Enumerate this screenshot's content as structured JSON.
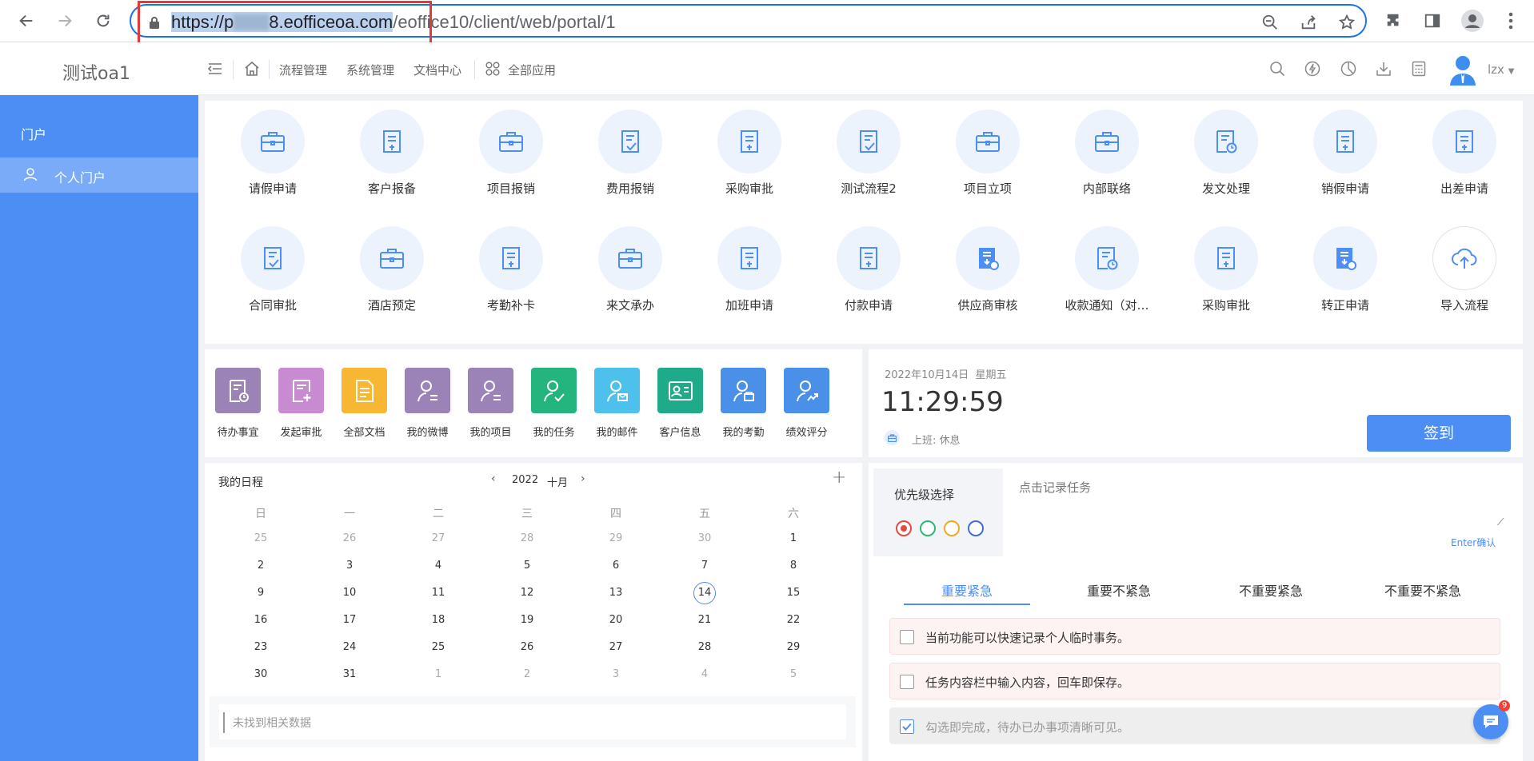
{
  "browser": {
    "url_selected": "https://p",
    "url_selected_tail": "8.eofficeoa.com",
    "url_rest": "/eoffice10/client/web/portal/1"
  },
  "header": {
    "app_title": "测试oa1",
    "nav": [
      "流程管理",
      "系统管理",
      "文档中心",
      "全部应用"
    ],
    "user_name": "lzx"
  },
  "sidebar": {
    "heading": "门户",
    "items": [
      {
        "label": "个人门户"
      }
    ]
  },
  "apps": [
    {
      "label": "请假申请",
      "icon": "briefcase-icon"
    },
    {
      "label": "客户报备",
      "icon": "form-icon"
    },
    {
      "label": "项目报销",
      "icon": "briefcase-icon"
    },
    {
      "label": "费用报销",
      "icon": "doc-check-icon"
    },
    {
      "label": "采购审批",
      "icon": "form-icon"
    },
    {
      "label": "测试流程2",
      "icon": "doc-check-icon"
    },
    {
      "label": "项目立项",
      "icon": "briefcase-icon"
    },
    {
      "label": "内部联络",
      "icon": "briefcase-icon"
    },
    {
      "label": "发文处理",
      "icon": "doc-clock-icon"
    },
    {
      "label": "销假申请",
      "icon": "form-icon"
    },
    {
      "label": "出差申请",
      "icon": "form-icon"
    },
    {
      "label": "合同审批",
      "icon": "doc-check-icon"
    },
    {
      "label": "酒店预定",
      "icon": "briefcase-icon"
    },
    {
      "label": "考勤补卡",
      "icon": "form-icon"
    },
    {
      "label": "来文承办",
      "icon": "briefcase-icon"
    },
    {
      "label": "加班申请",
      "icon": "form-icon"
    },
    {
      "label": "付款申请",
      "icon": "form-icon"
    },
    {
      "label": "供应商审核",
      "icon": "doc-filled-icon"
    },
    {
      "label": "收款通知（对…",
      "icon": "doc-clock-icon"
    },
    {
      "label": "采购审批",
      "icon": "form-icon"
    },
    {
      "label": "转正申请",
      "icon": "doc-filled-icon"
    },
    {
      "label": "导入流程",
      "icon": "cloud-upload-icon"
    }
  ],
  "quick": [
    {
      "label": "待办事宜",
      "color": "#9b83b8"
    },
    {
      "label": "发起审批",
      "color": "#c88bd1"
    },
    {
      "label": "全部文档",
      "color": "#f7b733"
    },
    {
      "label": "我的微博",
      "color": "#9b83b8"
    },
    {
      "label": "我的项目",
      "color": "#9b83b8"
    },
    {
      "label": "我的任务",
      "color": "#24b47e"
    },
    {
      "label": "我的邮件",
      "color": "#4ec0ec"
    },
    {
      "label": "客户信息",
      "color": "#1faa8a"
    },
    {
      "label": "我的考勤",
      "color": "#4a90e8"
    },
    {
      "label": "绩效评分",
      "color": "#4a90e8"
    }
  ],
  "calendar": {
    "title": "我的日程",
    "year": "2022",
    "month": "十月",
    "weekdays": [
      "日",
      "一",
      "二",
      "三",
      "四",
      "五",
      "六"
    ],
    "weeks": [
      [
        "25",
        "26",
        "27",
        "28",
        "29",
        "30",
        "1"
      ],
      [
        "2",
        "3",
        "4",
        "5",
        "6",
        "7",
        "8"
      ],
      [
        "9",
        "10",
        "11",
        "12",
        "13",
        "14",
        "15"
      ],
      [
        "16",
        "17",
        "18",
        "19",
        "20",
        "21",
        "22"
      ],
      [
        "23",
        "24",
        "25",
        "26",
        "27",
        "28",
        "29"
      ],
      [
        "30",
        "31",
        "1",
        "2",
        "3",
        "4",
        "5"
      ]
    ],
    "today": "14",
    "empty_text": "未找到相关数据"
  },
  "clock": {
    "date": "2022年10月14日",
    "weekday": "星期五",
    "time": "11:29:59",
    "shift_label": "上班:",
    "shift_value": "休息",
    "sign_button": "签到"
  },
  "tasks": {
    "priority_label": "优先级选择",
    "input_placeholder": "点击记录任务",
    "enter_hint": "Enter确认",
    "priority_colors": [
      "#e84a3c",
      "#2eb872",
      "#f5a623",
      "#3d6fd6"
    ],
    "tabs": [
      "重要紧急",
      "重要不紧急",
      "不重要紧急",
      "不重要不紧急"
    ],
    "items": [
      {
        "text": "当前功能可以快速记录个人临时事务。",
        "checked": false
      },
      {
        "text": "任务内容栏中输入内容，回车即保存。",
        "checked": false
      },
      {
        "text": "勾选即完成，待办已办事项清晰可见。",
        "checked": true
      }
    ]
  },
  "chat": {
    "badge": "9"
  }
}
